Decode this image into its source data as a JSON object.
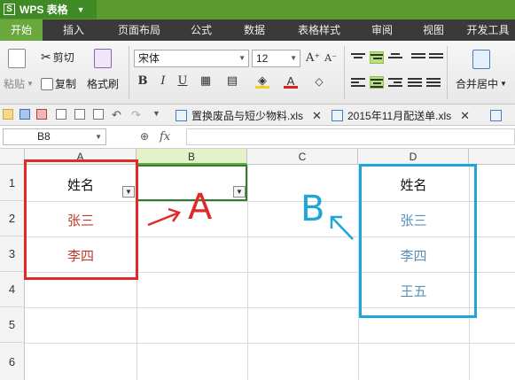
{
  "app": {
    "title": "WPS 表格"
  },
  "menu": {
    "items": [
      "开始",
      "插入",
      "页面布局",
      "公式",
      "数据",
      "表格样式",
      "审阅",
      "视图",
      "开发工具"
    ],
    "active": "开始"
  },
  "toolbar": {
    "paste": "粘贴",
    "cut": "剪切",
    "copy": "复制",
    "format_painter": "格式刷",
    "font_name": "宋体",
    "font_size": "12",
    "merge_center": "合并居中"
  },
  "tabs": [
    {
      "name": "置换废品与短少物料.xls"
    },
    {
      "name": "2015年11月配送单.xls"
    }
  ],
  "formula_bar": {
    "cell_ref": "B8",
    "fx": "fx",
    "value": ""
  },
  "columns": [
    "A",
    "B",
    "C",
    "D"
  ],
  "rows": [
    "1",
    "2",
    "3",
    "4",
    "5",
    "6"
  ],
  "cells": {
    "A1": "姓名",
    "A2": "张三",
    "A3": "李四",
    "D1": "姓名",
    "D2": "张三",
    "D3": "李四",
    "D4": "王五"
  },
  "annotations": {
    "left_label": "A",
    "right_label": "B"
  },
  "colors": {
    "accent": "#6aa83d",
    "annotation_red": "#e02a2a",
    "annotation_blue": "#1ea6d8",
    "red_text": "#c0392b",
    "blue_text": "#5b8fb7"
  }
}
